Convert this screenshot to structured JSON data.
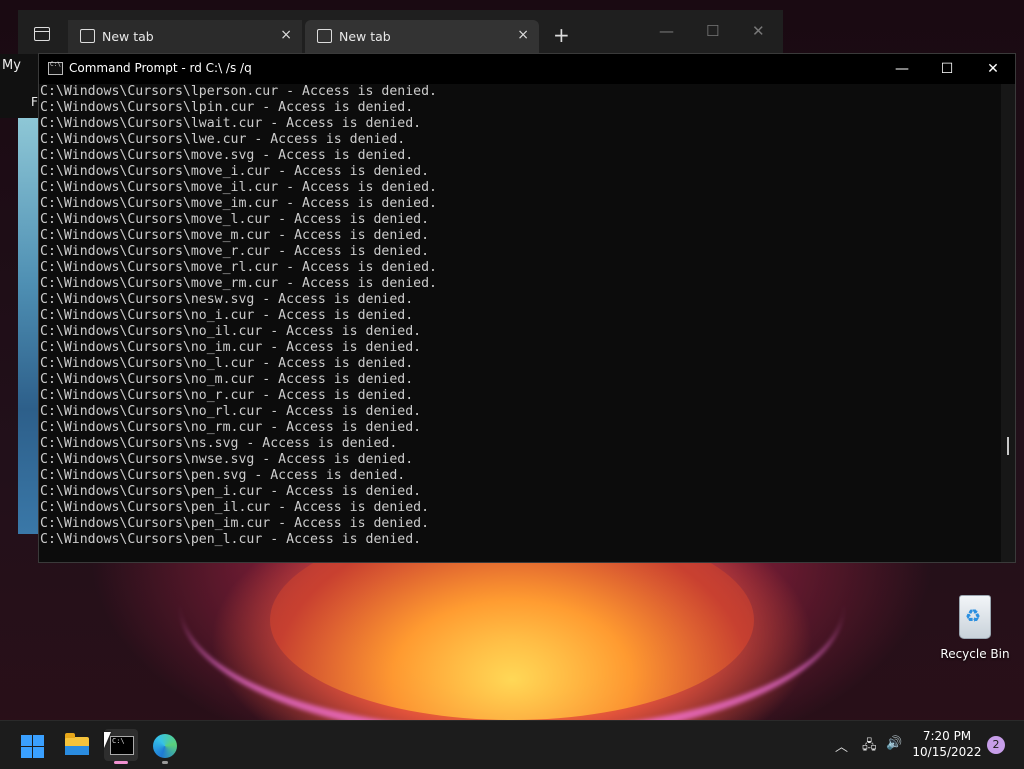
{
  "background_window": {
    "title_fragment": "My",
    "label_fragment": "F"
  },
  "terminal_tabs": {
    "tabs": [
      {
        "label": "New tab",
        "close": "×"
      },
      {
        "label": "New tab",
        "close": "×"
      }
    ],
    "new_tab": "+",
    "controls": {
      "minimize": "—",
      "maximize": "☐",
      "close": "✕"
    }
  },
  "cmd_window": {
    "title": "Command Prompt - rd  C:\\ /s /q",
    "controls": {
      "minimize": "—",
      "maximize": "☐",
      "close": "✕"
    },
    "lines": [
      "C:\\Windows\\Cursors\\lperson.cur - Access is denied.",
      "C:\\Windows\\Cursors\\lpin.cur - Access is denied.",
      "C:\\Windows\\Cursors\\lwait.cur - Access is denied.",
      "C:\\Windows\\Cursors\\lwe.cur - Access is denied.",
      "C:\\Windows\\Cursors\\move.svg - Access is denied.",
      "C:\\Windows\\Cursors\\move_i.cur - Access is denied.",
      "C:\\Windows\\Cursors\\move_il.cur - Access is denied.",
      "C:\\Windows\\Cursors\\move_im.cur - Access is denied.",
      "C:\\Windows\\Cursors\\move_l.cur - Access is denied.",
      "C:\\Windows\\Cursors\\move_m.cur - Access is denied.",
      "C:\\Windows\\Cursors\\move_r.cur - Access is denied.",
      "C:\\Windows\\Cursors\\move_rl.cur - Access is denied.",
      "C:\\Windows\\Cursors\\move_rm.cur - Access is denied.",
      "C:\\Windows\\Cursors\\nesw.svg - Access is denied.",
      "C:\\Windows\\Cursors\\no_i.cur - Access is denied.",
      "C:\\Windows\\Cursors\\no_il.cur - Access is denied.",
      "C:\\Windows\\Cursors\\no_im.cur - Access is denied.",
      "C:\\Windows\\Cursors\\no_l.cur - Access is denied.",
      "C:\\Windows\\Cursors\\no_m.cur - Access is denied.",
      "C:\\Windows\\Cursors\\no_r.cur - Access is denied.",
      "C:\\Windows\\Cursors\\no_rl.cur - Access is denied.",
      "C:\\Windows\\Cursors\\no_rm.cur - Access is denied.",
      "C:\\Windows\\Cursors\\ns.svg - Access is denied.",
      "C:\\Windows\\Cursors\\nwse.svg - Access is denied.",
      "C:\\Windows\\Cursors\\pen.svg - Access is denied.",
      "C:\\Windows\\Cursors\\pen_i.cur - Access is denied.",
      "C:\\Windows\\Cursors\\pen_il.cur - Access is denied.",
      "C:\\Windows\\Cursors\\pen_im.cur - Access is denied.",
      "C:\\Windows\\Cursors\\pen_l.cur - Access is denied."
    ]
  },
  "desktop": {
    "recycle_bin_label": "Recycle Bin"
  },
  "taskbar": {
    "apps": [
      "windows-start-icon",
      "file-explorer-icon",
      "command-prompt-icon",
      "edge-browser-icon"
    ],
    "tray": {
      "chevron": "︿",
      "network": "🖧",
      "volume": "🔊"
    },
    "time": "7:20 PM",
    "date": "10/15/2022",
    "notification_count": "2"
  }
}
